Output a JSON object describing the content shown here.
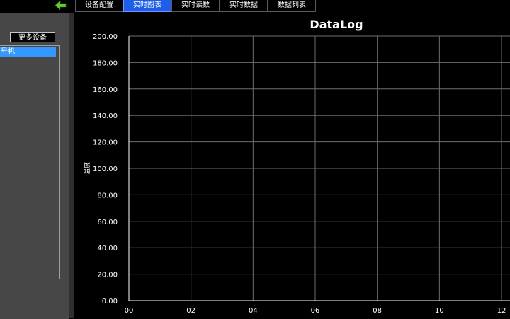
{
  "tabs": [
    {
      "label": "设备配置",
      "active": false
    },
    {
      "label": "实时图表",
      "active": true
    },
    {
      "label": "实时读数",
      "active": false
    },
    {
      "label": "实时数据",
      "active": false
    },
    {
      "label": "数据列表",
      "active": false
    }
  ],
  "back_icon": "back-arrow-icon",
  "sidebar": {
    "more_devices_label": "更多设备",
    "device_item_label": "号机"
  },
  "colors": {
    "tab_active": "#1e5ee8",
    "sidebar_bg": "#474747",
    "selected_item": "#3399ff",
    "back_arrow": "#66cc33",
    "grid": "#6e6e6e"
  },
  "chart_data": {
    "type": "line",
    "title": "DataLog",
    "ylabel": "温度",
    "xlabel": "",
    "xlim": [
      0,
      12
    ],
    "ylim": [
      0,
      200
    ],
    "x_ticks": [
      {
        "value": 0,
        "label": "00"
      },
      {
        "value": 2,
        "label": "02"
      },
      {
        "value": 4,
        "label": "04"
      },
      {
        "value": 6,
        "label": "06"
      },
      {
        "value": 8,
        "label": "08"
      },
      {
        "value": 10,
        "label": "10"
      },
      {
        "value": 12,
        "label": "12"
      }
    ],
    "y_ticks": [
      {
        "value": 0,
        "label": "0.00"
      },
      {
        "value": 20,
        "label": "20.00"
      },
      {
        "value": 40,
        "label": "40.00"
      },
      {
        "value": 60,
        "label": "60.00"
      },
      {
        "value": 80,
        "label": "80.00"
      },
      {
        "value": 100,
        "label": "100.00"
      },
      {
        "value": 120,
        "label": "120.00"
      },
      {
        "value": 140,
        "label": "140.00"
      },
      {
        "value": 160,
        "label": "160.00"
      },
      {
        "value": 180,
        "label": "180.00"
      },
      {
        "value": 200,
        "label": "200.00"
      }
    ],
    "grid": true,
    "series": []
  }
}
